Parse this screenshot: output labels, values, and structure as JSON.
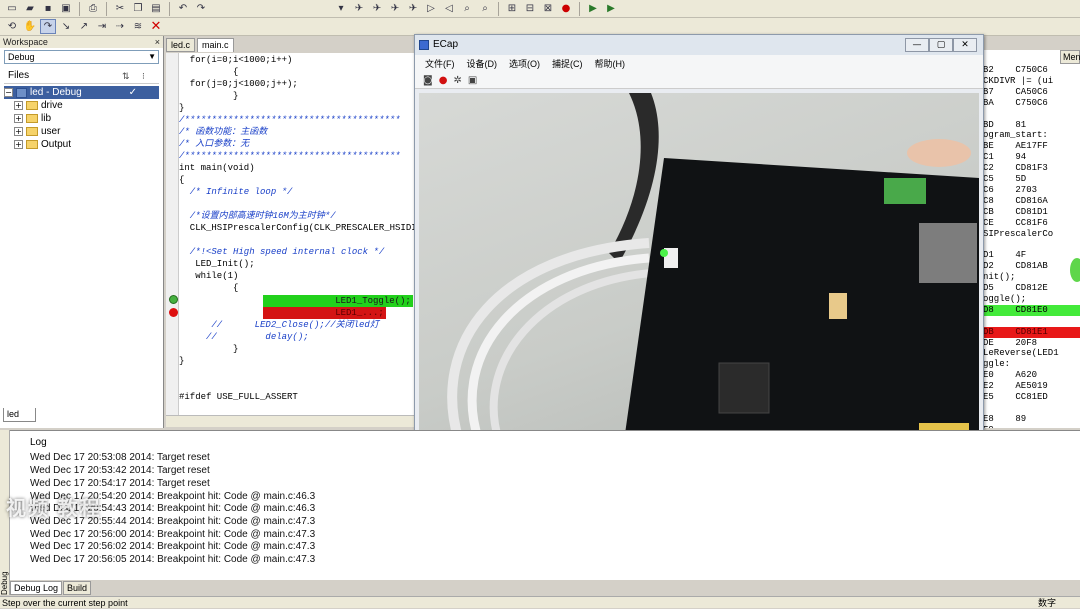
{
  "toolbar_top": {
    "icons": [
      "new-file-icon",
      "open-icon",
      "save-icon",
      "save-all-icon",
      "print-icon",
      "cut-icon",
      "copy-icon",
      "paste-icon",
      "undo-icon",
      "redo-icon"
    ]
  },
  "workspace": {
    "title": "Workspace",
    "close": "×",
    "config_select": "Debug",
    "files_label": "Files",
    "project": "led - Debug",
    "project_check": "✓",
    "folders": [
      "drive",
      "lib",
      "user",
      "Output"
    ],
    "bottom_tab": "led"
  },
  "editor": {
    "tabs": [
      "led.c",
      "main.c"
    ],
    "lines": [
      "  for(i=0;i<1000;i++)",
      "          {",
      "  for(j=0;j<1000;j++);",
      "          }",
      "}",
      "/****************************************",
      "/* 函数功能：主函数",
      "/* 入口参数：无",
      "/****************************************",
      "int main(void)",
      "{",
      "  /* Infinite loop */",
      "",
      "  /*设置内部高速时钟16M为主时钟*/",
      "  CLK_HSIPrescalerConfig(CLK_PRESCALER_HSIDIV",
      "",
      "  /*!<Set High speed internal clock */",
      "   LED_Init();",
      "   while(1)",
      "          {",
      "             LED1_Toggle();",
      "             LED1_...;",
      "      //      LED2_Close();//关闭led灯",
      "     //         delay();",
      "          }",
      "}",
      "",
      "",
      "#ifdef USE_FULL_ASSERT"
    ]
  },
  "disassembly": {
    "tab": "Men",
    "lines": [
      "B2    C750C6",
      "CKDIVR |= (ui",
      "B7    CA50C6",
      "BA    C750C6",
      "",
      "BD    81",
      "ogram_start:",
      "BE    AE17FF",
      "C1    94",
      "C2    CD81F3",
      "C5    5D",
      "C6    2703",
      "C8    CD816A",
      "CB    CD81D1",
      "CE    CC81F6",
      "SIPrescalerCo",
      "",
      "D1    4F",
      "D2    CD81AB",
      "nit();",
      "D5    CD812E",
      "oggle();",
      "D8    CD81E0",
      "",
      "DB    CD81E1",
      "DE    20F8",
      "LeReverse(LED1",
      "ggle:",
      "E0    A620",
      "E2    AE5019",
      "E5    CC81ED",
      "",
      "E8    89",
      "E9    ..."
    ]
  },
  "ecap": {
    "title": "ECap",
    "min": "—",
    "max": "▢",
    "close": "✕",
    "menu": [
      "文件(F)",
      "设备(D)",
      "选项(O)",
      "捕捉(C)",
      "帮助(H)"
    ],
    "tools": [
      "camera-icon",
      "record-icon",
      "settings-icon",
      "image-icon"
    ]
  },
  "log": {
    "title": "Log",
    "entries": [
      "Wed Dec 17 20:53:08 2014: Target reset",
      "Wed Dec 17 20:53:42 2014: Target reset",
      "Wed Dec 17 20:54:17 2014: Target reset",
      "Wed Dec 17 20:54:20 2014: Breakpoint hit: Code @ main.c:46.3",
      "Wed Dec 17 20:54:43 2014: Breakpoint hit: Code @ main.c:46.3",
      "Wed Dec 17 20:55:44 2014: Breakpoint hit: Code @ main.c:47.3",
      "Wed Dec 17 20:56:00 2014: Breakpoint hit: Code @ main.c:47.3",
      "Wed Dec 17 20:56:02 2014: Breakpoint hit: Code @ main.c:47.3",
      "Wed Dec 17 20:56:05 2014: Breakpoint hit: Code @ main.c:47.3"
    ],
    "tabs": [
      "Debug Log",
      "Build"
    ],
    "side_label": "Debug Log"
  },
  "status": {
    "left": "Step over the current step point",
    "right": "数字"
  },
  "watermark": "视频 教程",
  "colors": {
    "highlight_green": "#22d11c",
    "highlight_red": "#d41414",
    "comment_blue": "#1a40c8"
  }
}
